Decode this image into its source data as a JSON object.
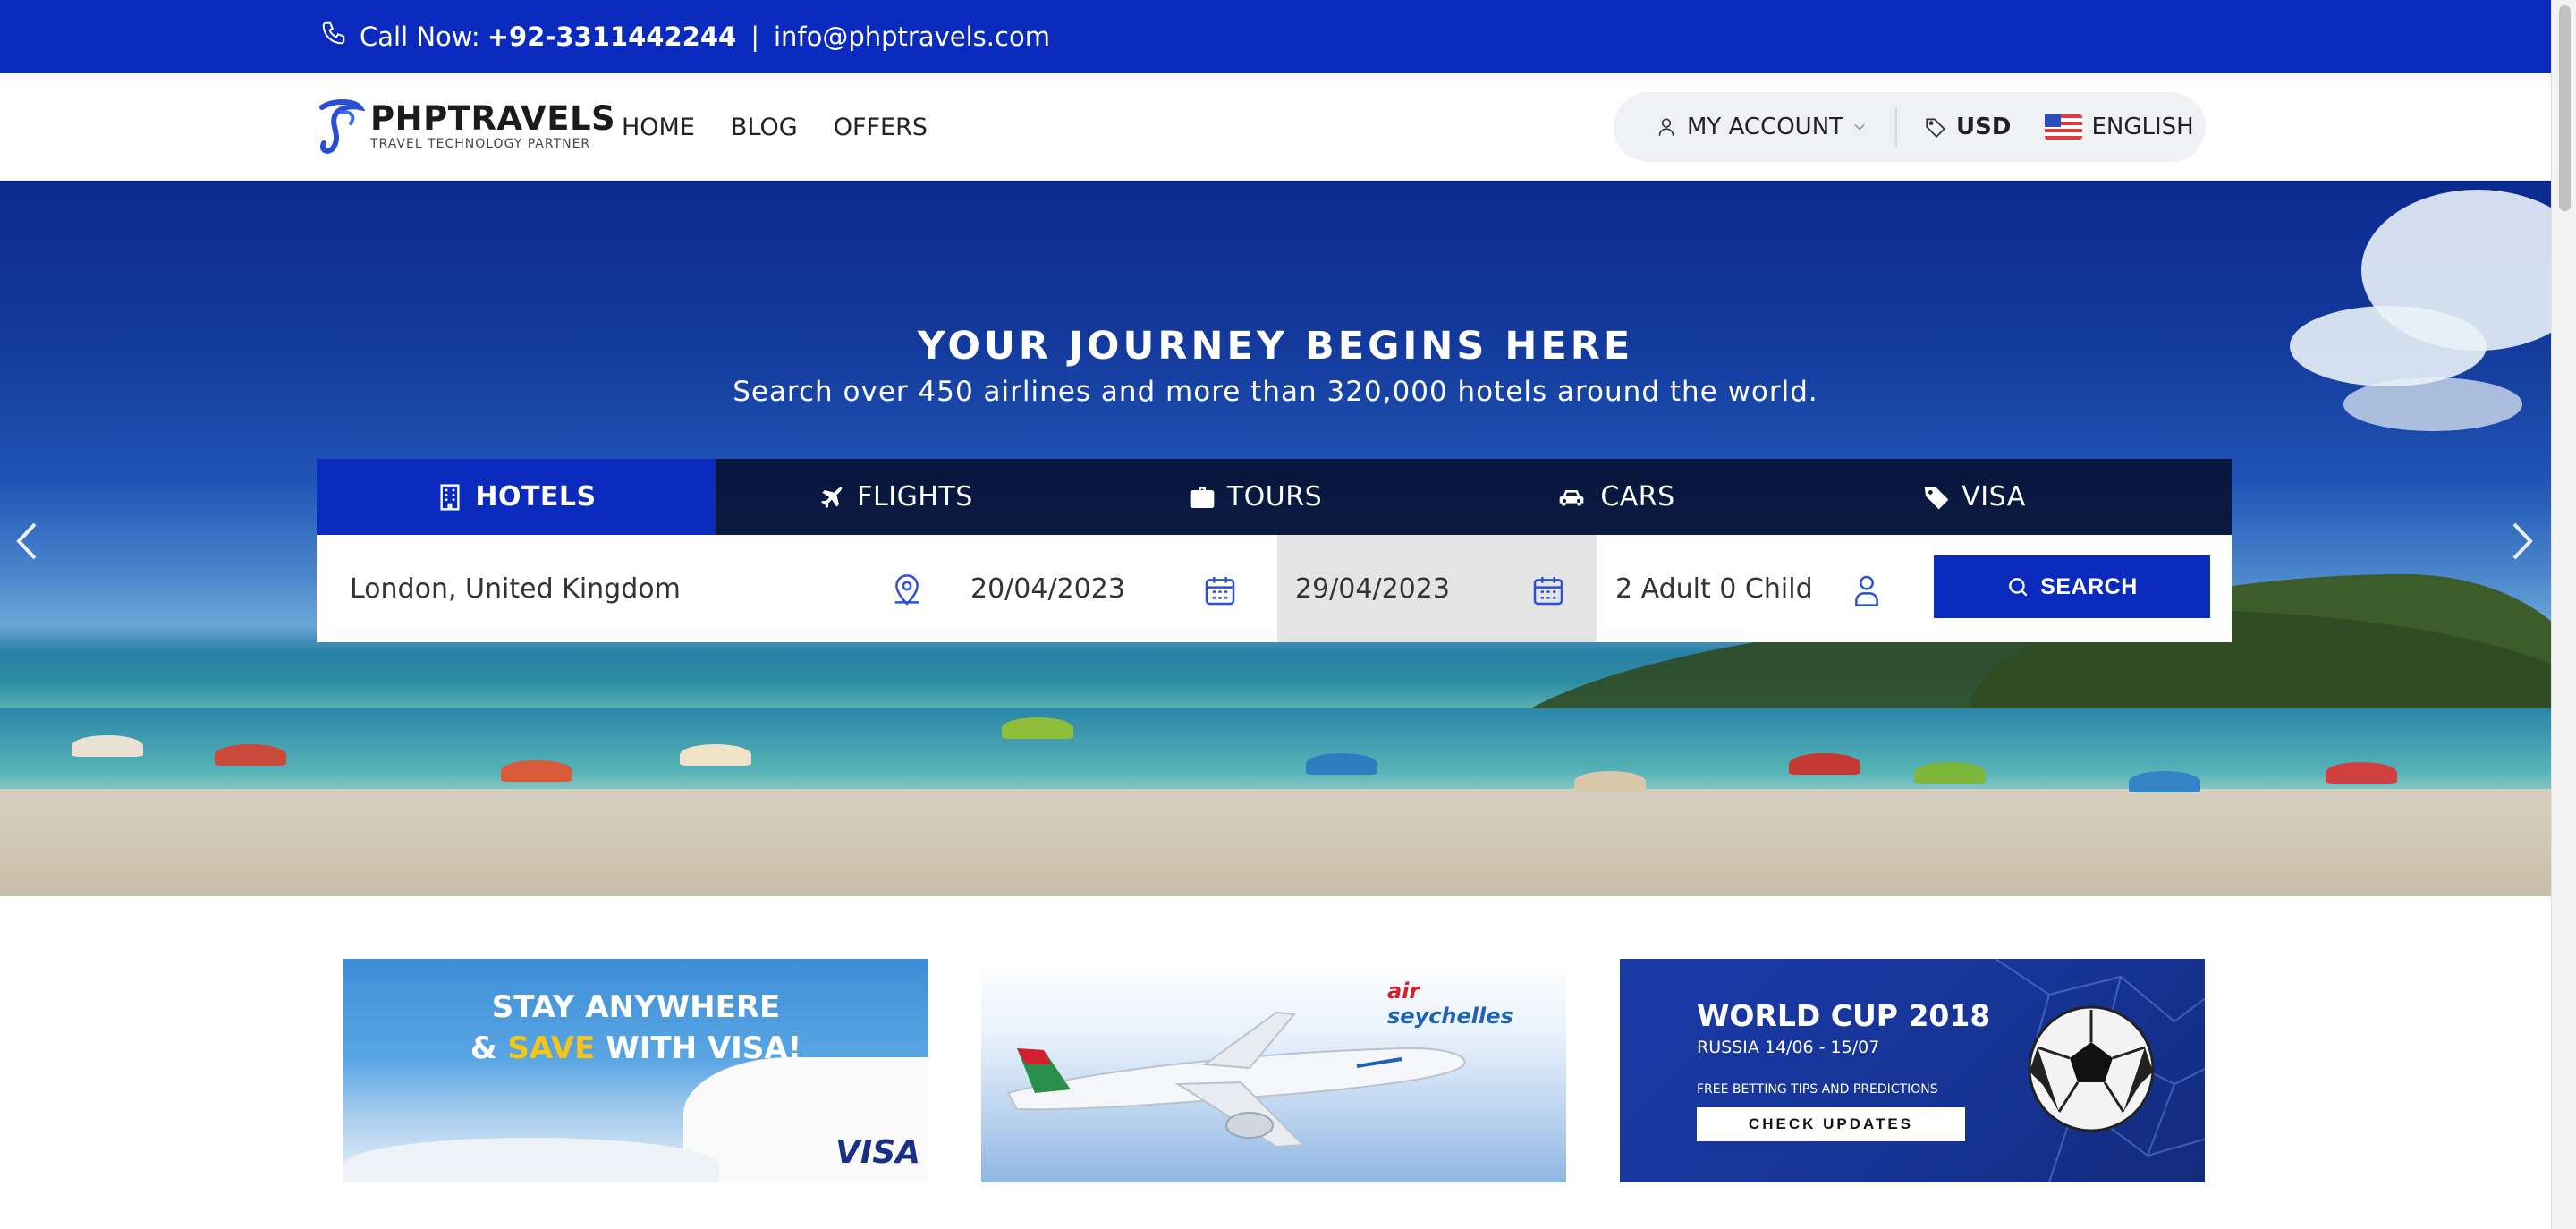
{
  "topbar": {
    "call_label": "Call Now:",
    "phone": "+92-3311442244",
    "separator": "|",
    "email": "info@phptravels.com"
  },
  "brand": {
    "name": "PHPTRAVELS",
    "tagline": "TRAVEL TECHNOLOGY PARTNER",
    "accent_color": "#0a2bbd"
  },
  "nav": {
    "links": [
      "HOME",
      "BLOG",
      "OFFERS"
    ]
  },
  "account": {
    "my_account": "MY ACCOUNT",
    "currency": "USD",
    "language": "ENGLISH"
  },
  "hero": {
    "title": "YOUR JOURNEY BEGINS HERE",
    "subtitle": "Search over 450 airlines and more than 320,000 hotels around the world."
  },
  "tabs": [
    {
      "label": "HOTELS",
      "icon": "hotel-icon",
      "active": true
    },
    {
      "label": "FLIGHTS",
      "icon": "plane-icon",
      "active": false
    },
    {
      "label": "TOURS",
      "icon": "suitcase-icon",
      "active": false
    },
    {
      "label": "CARS",
      "icon": "car-icon",
      "active": false
    },
    {
      "label": "VISA",
      "icon": "tag-icon",
      "active": false
    }
  ],
  "search": {
    "destination": "London, United Kingdom",
    "checkin": "20/04/2023",
    "checkout": "29/04/2023",
    "guests": "2 Adult 0 Child",
    "button": "SEARCH"
  },
  "banners": {
    "visa": {
      "line1": "STAY ANYWHERE",
      "line2_prefix": "& ",
      "line2_highlight": "SAVE",
      "line2_suffix": " WITH VISA!",
      "brand": "VISA"
    },
    "airline": {
      "brand_top": "air",
      "brand_bottom": "seychelles"
    },
    "worldcup": {
      "title": "WORLD CUP 2018",
      "subtitle": "RUSSIA 14/06 - 15/07",
      "tips": "FREE BETTING TIPS AND PREDICTIONS",
      "cta": "CHECK UPDATES"
    }
  }
}
